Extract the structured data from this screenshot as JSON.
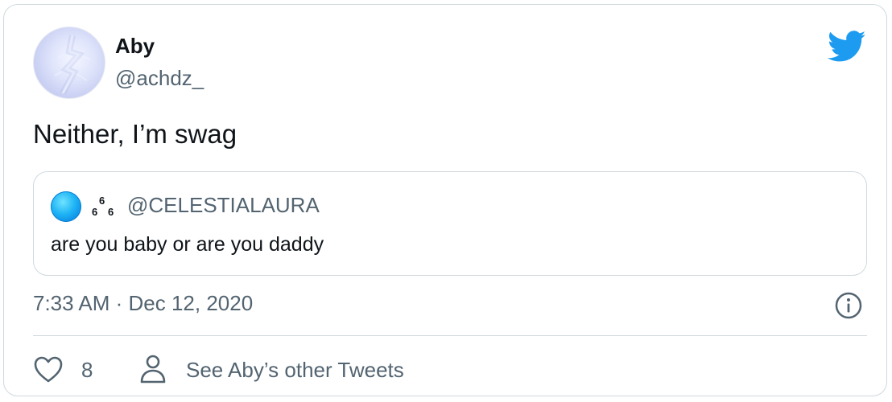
{
  "author": {
    "name": "Aby",
    "handle": "@achdz_"
  },
  "tweet": {
    "text": "Neither, I’m swag"
  },
  "quoted_tweet": {
    "name_chars": [
      "6",
      "6",
      "6"
    ],
    "handle": "@CELESTIALAURA",
    "text": "are you baby or are you daddy"
  },
  "meta": {
    "timestamp": "7:33 AM · Dec 12, 2020"
  },
  "actions": {
    "like_count": "8",
    "other_tweets_label": "See Aby’s other Tweets"
  },
  "icons": {
    "brand": "twitter-bird-icon",
    "info": "info-icon",
    "like": "heart-icon",
    "profile": "user-icon"
  },
  "colors": {
    "twitter_blue": "#1d9bf0",
    "text_primary": "#0f1419",
    "text_secondary": "#536471",
    "border": "#cfd9de"
  }
}
